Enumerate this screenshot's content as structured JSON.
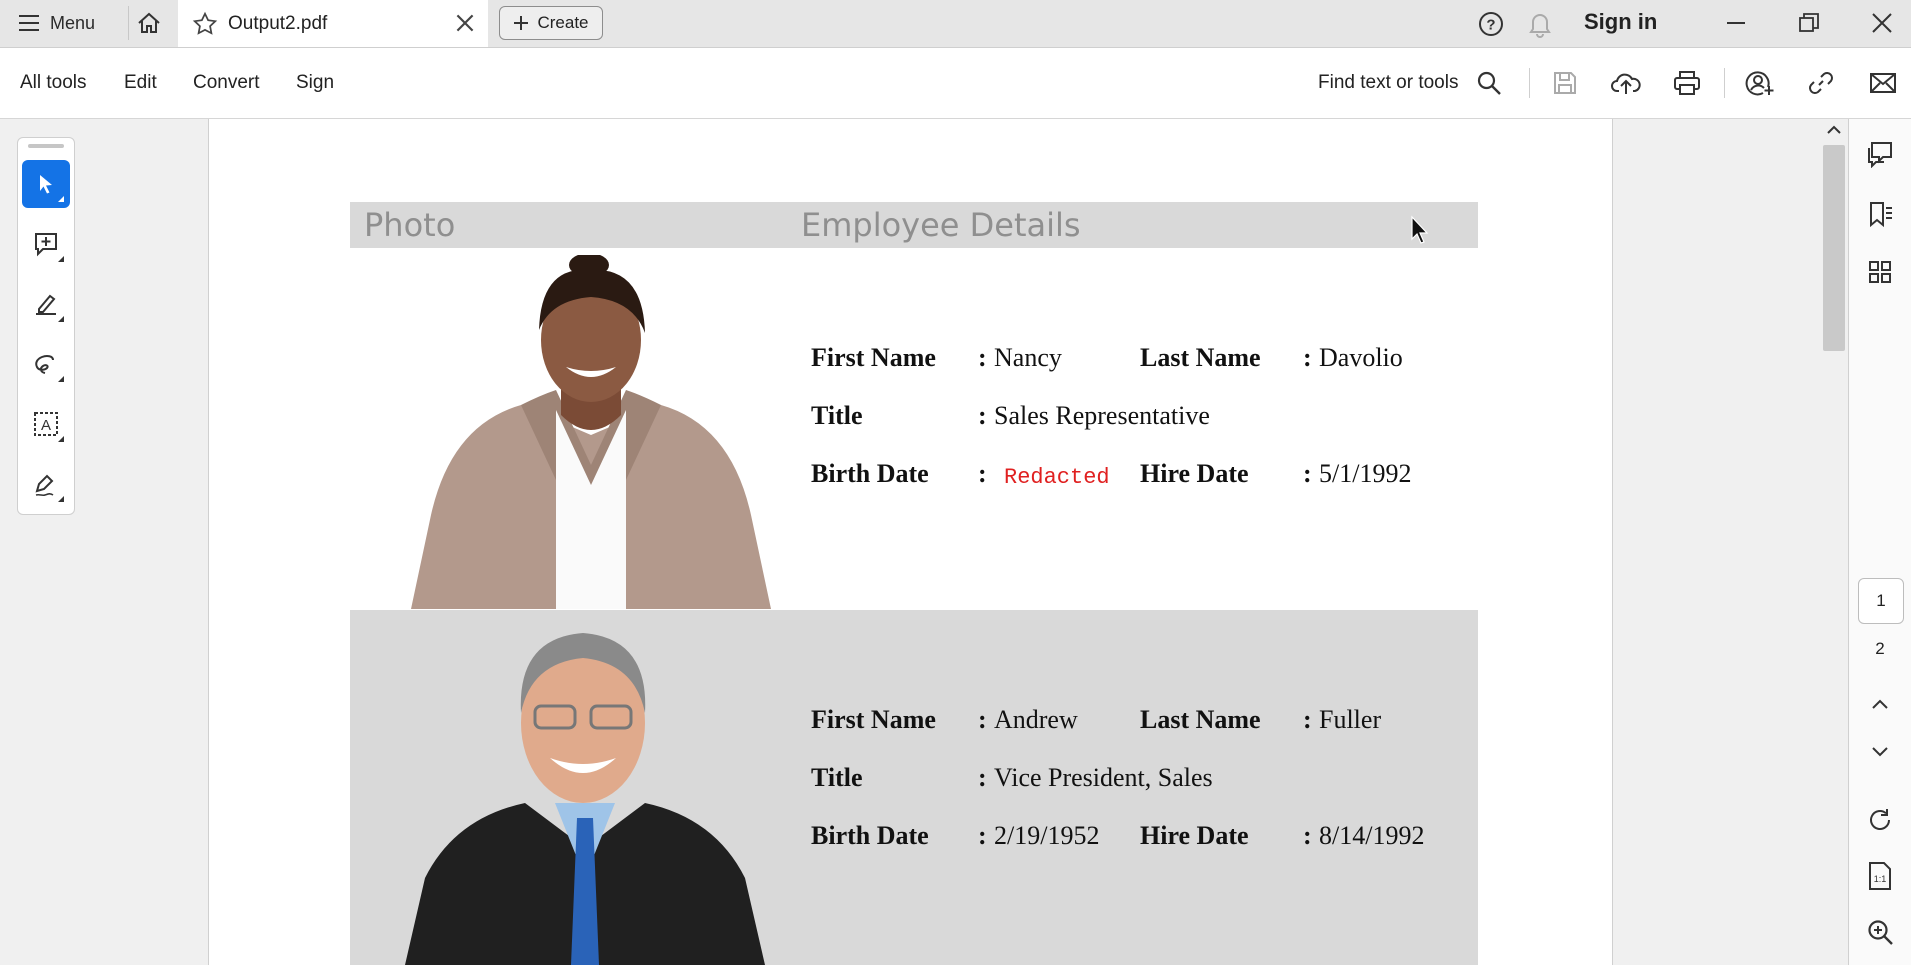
{
  "tabbar": {
    "menu_label": "Menu",
    "tab_title": "Output2.pdf",
    "create_label": "Create",
    "sign_in": "Sign in"
  },
  "toolbar": {
    "menu_items": [
      "All tools",
      "Edit",
      "Convert",
      "Sign"
    ],
    "find_label": "Find text or tools"
  },
  "pages": {
    "page1": "1",
    "page2": "2"
  },
  "document": {
    "header": {
      "photo": "Photo",
      "details": "Employee Details"
    },
    "labels": {
      "first_name": "First Name",
      "last_name": "Last Name",
      "title": "Title",
      "birth_date": "Birth Date",
      "hire_date": "Hire Date",
      "colon": ":"
    },
    "employees": [
      {
        "first_name": "Nancy",
        "last_name": "Davolio",
        "title": "Sales Representative",
        "birth_date": "Redacted",
        "hire_date": "5/1/1992"
      },
      {
        "first_name": "Andrew",
        "last_name": "Fuller",
        "title": "Vice President, Sales",
        "birth_date": "2/19/1952",
        "hire_date": "8/14/1992"
      }
    ]
  },
  "colors": {
    "accent": "#1473e6",
    "redacted": "#e02020",
    "table_header": "#d9d9d9"
  }
}
